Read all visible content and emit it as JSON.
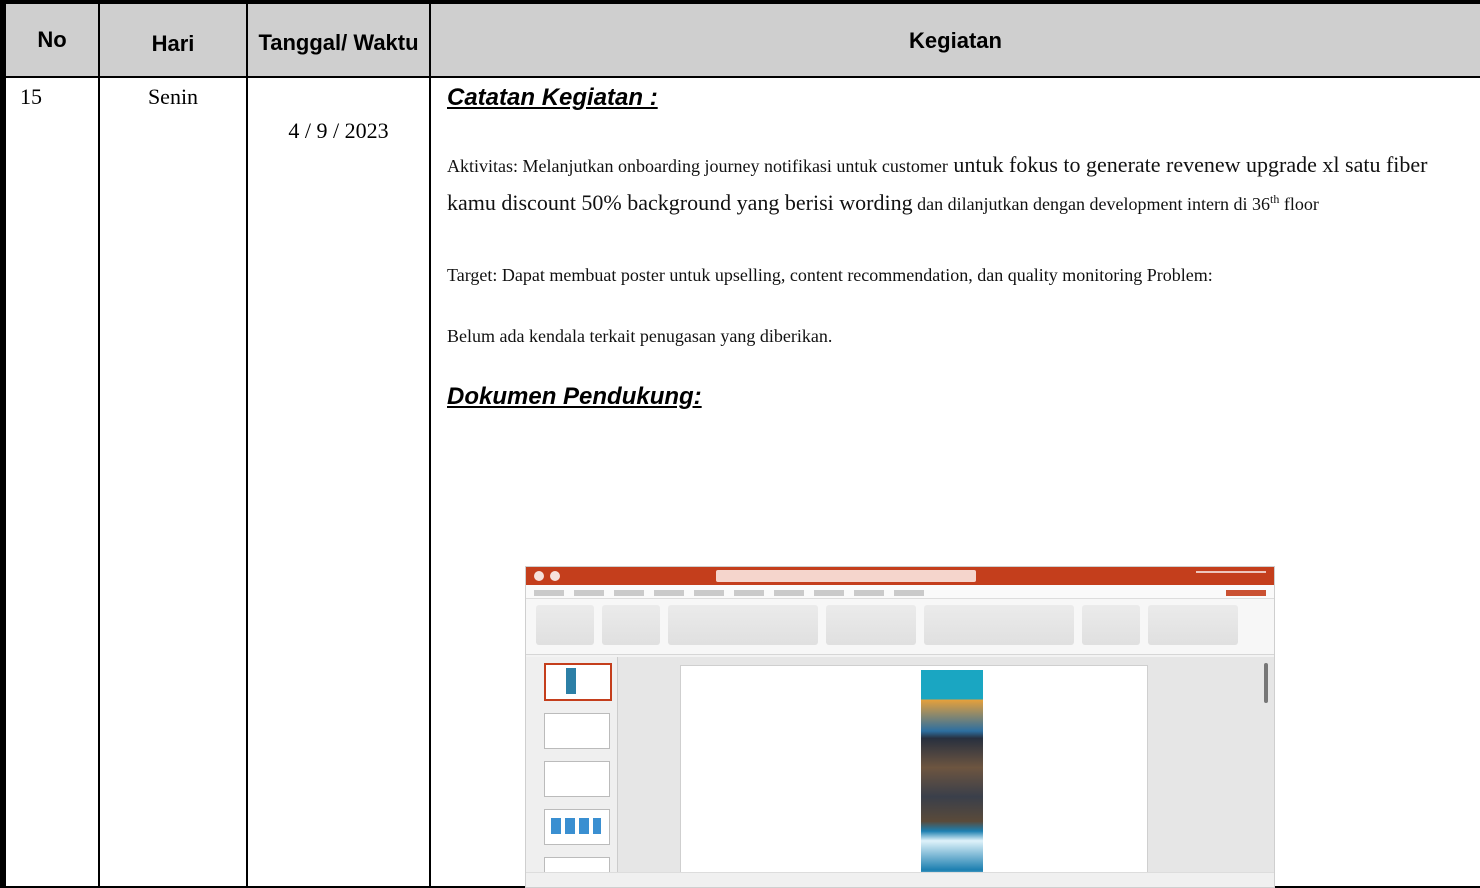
{
  "table": {
    "headers": {
      "no": "No",
      "hari": "Hari",
      "tanggal": "Tanggal/ Waktu",
      "kegiatan": "Kegiatan"
    },
    "row": {
      "no": "15",
      "hari": "Senin",
      "tanggal": "4 / 9 / 2023",
      "kegiatan": {
        "catatan_title": "Catatan Kegiatan :",
        "aktivitas_a": "Aktivitas: Melanjutkan onboarding journey notifikasi untuk customer",
        "aktivitas_b": " untuk fokus to generate revenew upgrade xl satu fiber kamu discount 50%  background yang berisi wording",
        "aktivitas_c": " dan dilanjutkan dengan development intern di 36",
        "aktivitas_sup": "th",
        "aktivitas_d": " floor",
        "target": "Target: Dapat membuat poster untuk upselling, content recommendation, dan quality monitoring Problem:",
        "problem": "Belum ada kendala terkait penugasan yang diberikan.",
        "dokumen_title": "Dokumen Pendukung:"
      }
    }
  },
  "colors": {
    "header_bg": "#cfcfcf",
    "powerpoint_accent": "#c43e1c"
  }
}
